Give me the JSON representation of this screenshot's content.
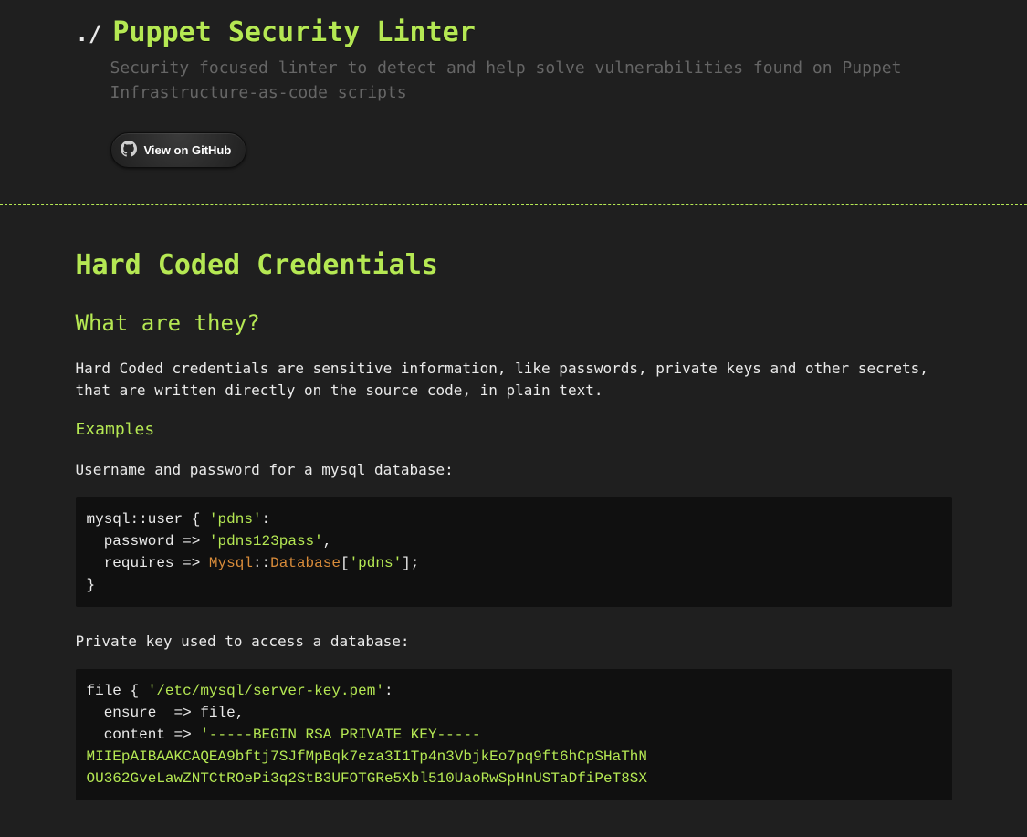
{
  "header": {
    "prompt": "./",
    "title": "Puppet Security Linter",
    "subtitle": "Security focused linter to detect and help solve vulnerabilities found on Puppet Infrastructure-as-code scripts",
    "github_label": "View on GitHub"
  },
  "main": {
    "h1": "Hard Coded Credentials",
    "h2": "What are they?",
    "intro": "Hard Coded credentials are sensitive information, like passwords, private keys and other secrets, that are written directly on the source code, in plain text.",
    "h3": "Examples",
    "example1_label": "Username and password for a mysql database:",
    "code1": {
      "l1a": "mysql::user { ",
      "l1b": "'pdns'",
      "l1c": ":",
      "l2a": "  password => ",
      "l2b": "'pdns123pass'",
      "l2c": ",",
      "l3a": "  requires => ",
      "l3b": "Mysql",
      "l3c": "::",
      "l3d": "Database",
      "l3e": "[",
      "l3f": "'pdns'",
      "l3g": "];",
      "l4": "}"
    },
    "example2_label": "Private key used to access a database:",
    "code2": {
      "l1a": "file { ",
      "l1b": "'/etc/mysql/server-key.pem'",
      "l1c": ":",
      "l2": "  ensure  => file,",
      "l3a": "  content => ",
      "l3b": "'-----BEGIN RSA PRIVATE KEY-----",
      "l4": "MIIEpAIBAAKCAQEA9bftj7SJfMpBqk7eza3I1Tp4n3VbjkEo7pq9ft6hCpSHaThN",
      "l5": "OU362GveLawZNTCtROePi3q2StB3UFOTGRe5Xbl510UaoRwSpHnUSTaDfiPeT8SX"
    }
  }
}
